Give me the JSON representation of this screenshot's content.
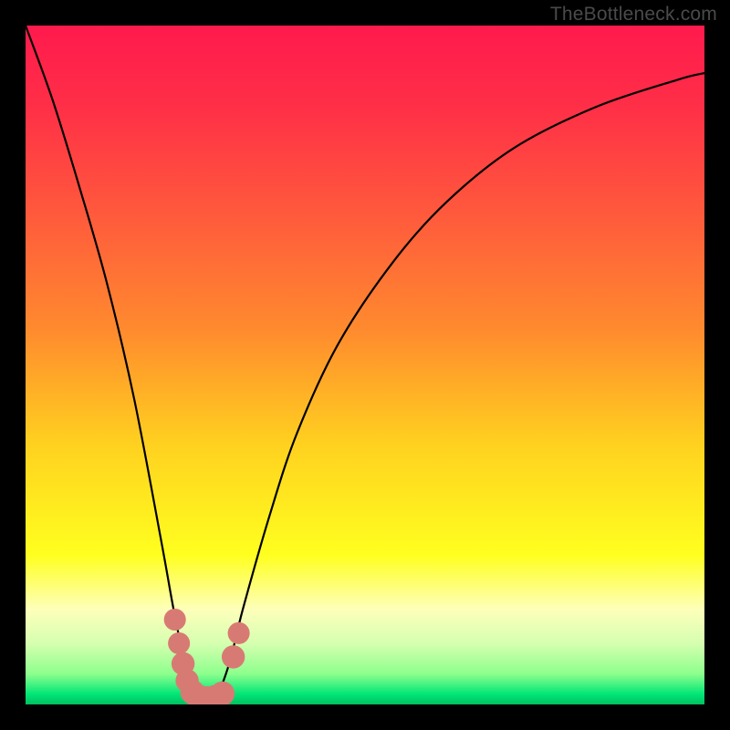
{
  "watermark": "TheBottleneck.com",
  "chart_data": {
    "type": "line",
    "title": "",
    "xlabel": "",
    "ylabel": "",
    "xlim": [
      0,
      100
    ],
    "ylim": [
      0,
      100
    ],
    "grid": false,
    "legend": false,
    "background": {
      "gradient_stops": [
        {
          "offset": 0.0,
          "color": "#ff1a4d"
        },
        {
          "offset": 0.12,
          "color": "#ff2f47"
        },
        {
          "offset": 0.28,
          "color": "#ff5a3c"
        },
        {
          "offset": 0.45,
          "color": "#ff8b2e"
        },
        {
          "offset": 0.62,
          "color": "#ffd21f"
        },
        {
          "offset": 0.78,
          "color": "#ffff1f"
        },
        {
          "offset": 0.86,
          "color": "#fdffba"
        },
        {
          "offset": 0.91,
          "color": "#d6ffb0"
        },
        {
          "offset": 0.955,
          "color": "#8dff8d"
        },
        {
          "offset": 0.985,
          "color": "#00e676"
        },
        {
          "offset": 1.0,
          "color": "#00c060"
        }
      ]
    },
    "curve": {
      "description": "V-shaped bottleneck curve; minimum near x≈26, value≈0; rises steeply on both sides",
      "x": [
        0,
        4,
        8,
        12,
        16,
        20,
        22,
        24,
        26,
        28,
        30,
        32,
        36,
        40,
        46,
        54,
        62,
        72,
        84,
        96,
        100
      ],
      "y": [
        100,
        89,
        76,
        62,
        45,
        24,
        13,
        4,
        0,
        1,
        6,
        14,
        28,
        40,
        53,
        65,
        74,
        82,
        88,
        92,
        93
      ]
    },
    "markers": {
      "description": "Salmon bead markers clustered near the minimum of the curve",
      "points": [
        {
          "x": 22.0,
          "y": 12.5,
          "r": 1.2
        },
        {
          "x": 22.6,
          "y": 9.0,
          "r": 1.2
        },
        {
          "x": 23.2,
          "y": 6.0,
          "r": 1.3
        },
        {
          "x": 23.8,
          "y": 3.5,
          "r": 1.3
        },
        {
          "x": 24.6,
          "y": 1.8,
          "r": 1.4
        },
        {
          "x": 25.6,
          "y": 1.0,
          "r": 1.5
        },
        {
          "x": 26.8,
          "y": 0.8,
          "r": 1.5
        },
        {
          "x": 28.0,
          "y": 1.0,
          "r": 1.5
        },
        {
          "x": 29.0,
          "y": 1.6,
          "r": 1.4
        },
        {
          "x": 30.6,
          "y": 7.0,
          "r": 1.3
        },
        {
          "x": 31.4,
          "y": 10.5,
          "r": 1.2
        }
      ],
      "color": "#d87a74"
    }
  }
}
